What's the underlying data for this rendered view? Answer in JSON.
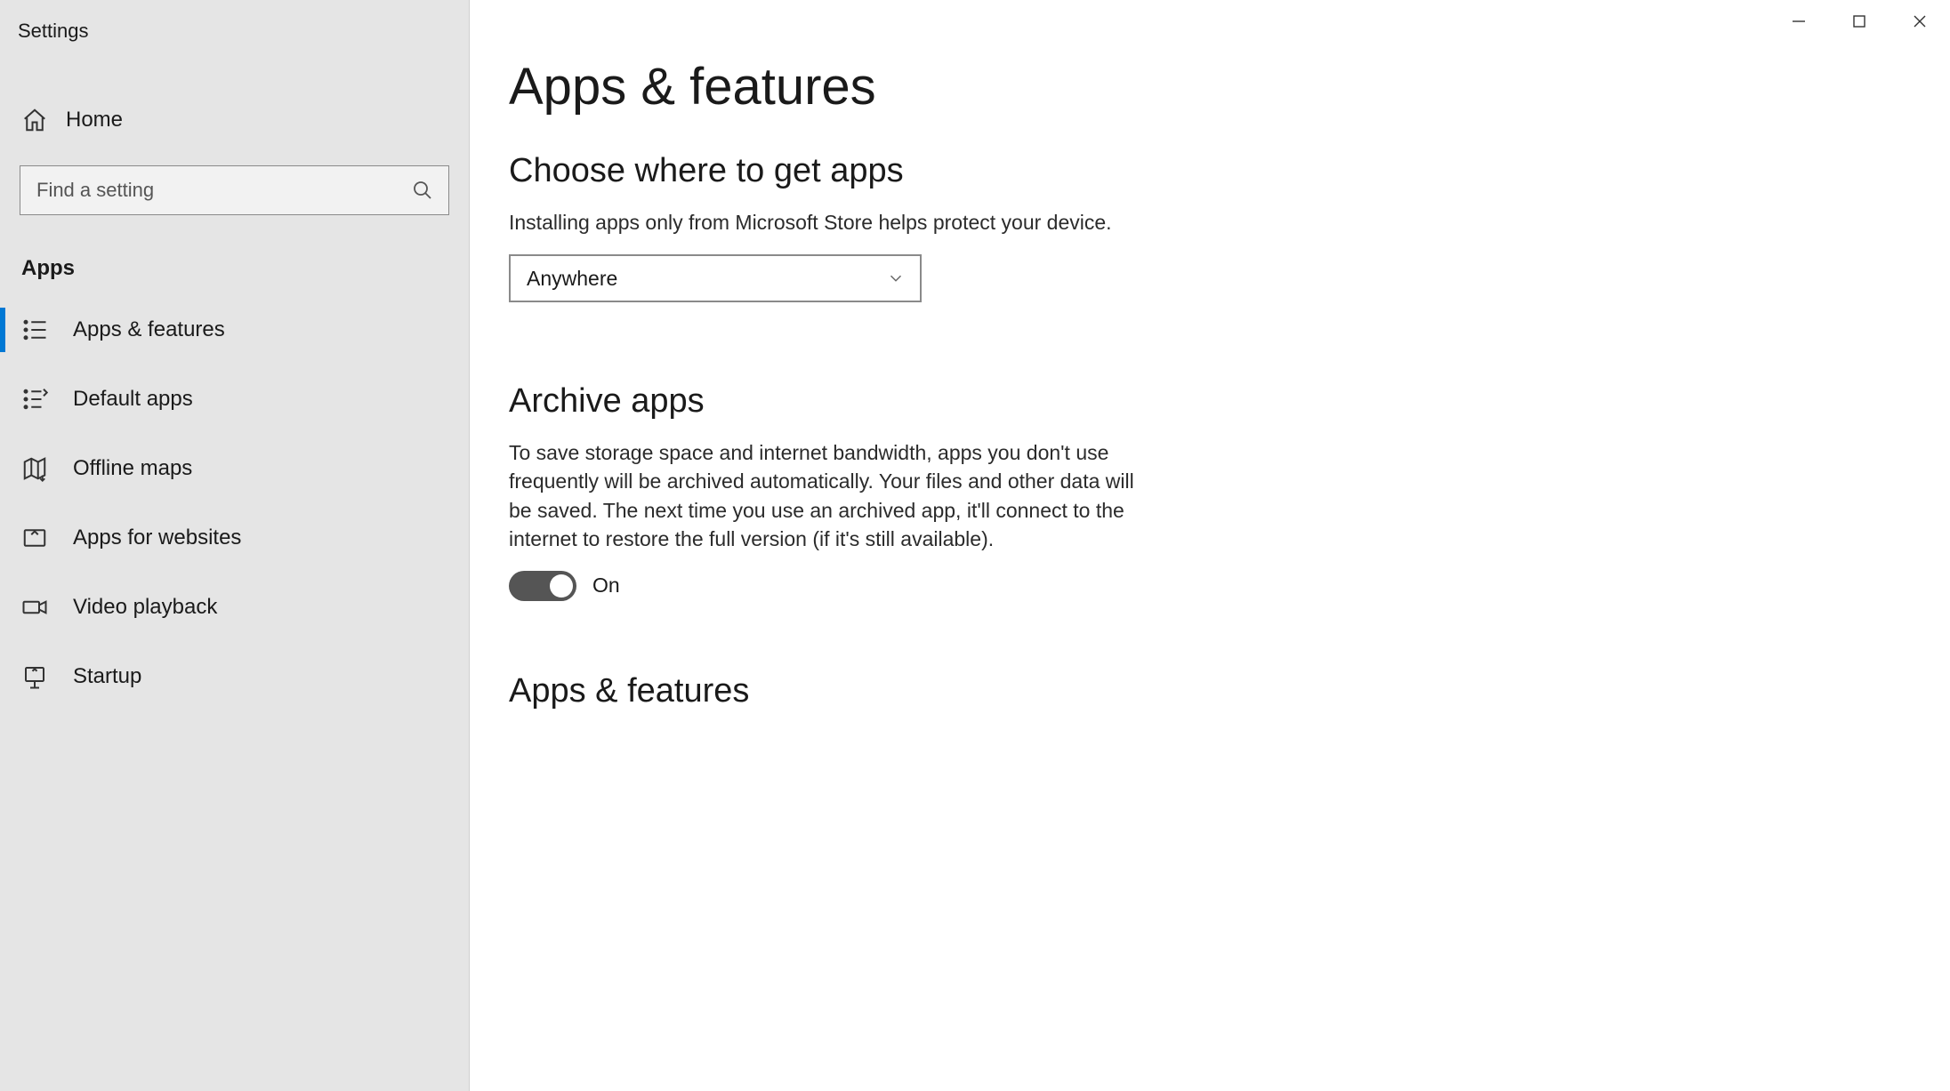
{
  "window": {
    "title": "Settings"
  },
  "sidebar": {
    "home": "Home",
    "search_placeholder": "Find a setting",
    "section": "Apps",
    "items": [
      {
        "label": "Apps & features",
        "active": true
      },
      {
        "label": "Default apps"
      },
      {
        "label": "Offline maps"
      },
      {
        "label": "Apps for websites"
      },
      {
        "label": "Video playback"
      },
      {
        "label": "Startup"
      }
    ]
  },
  "page": {
    "title": "Apps & features",
    "sections": {
      "where": {
        "title": "Choose where to get apps",
        "desc": "Installing apps only from Microsoft Store helps protect your device.",
        "select_value": "Anywhere"
      },
      "archive": {
        "title": "Archive apps",
        "desc": "To save storage space and internet bandwidth, apps you don't use frequently will be archived automatically. Your files and other data will be saved. The next time you use an archived app, it'll connect to the internet to restore the full version (if it's still available).",
        "toggle_on": true,
        "toggle_label": "On"
      },
      "apps_list": {
        "title": "Apps & features"
      }
    }
  }
}
